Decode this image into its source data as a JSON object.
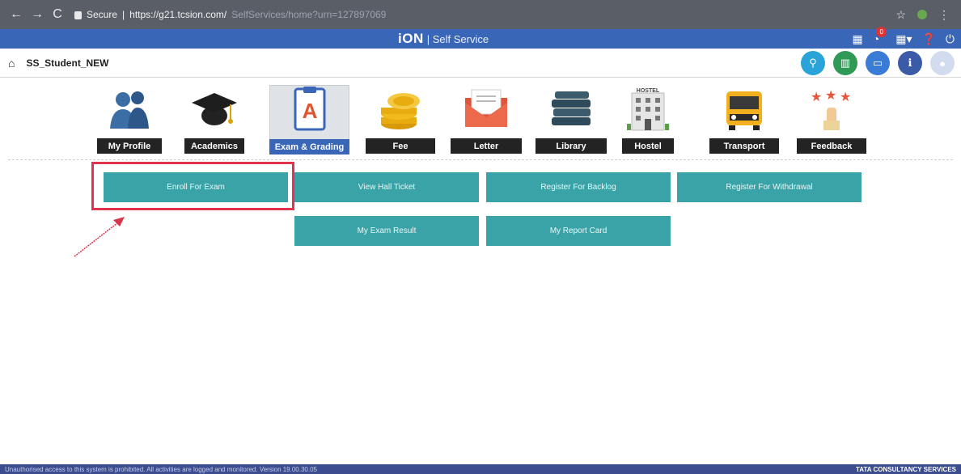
{
  "browser": {
    "secure_label": "Secure",
    "url_main": "https://g21.tcsion.com/",
    "url_rest": "SelfServices/home?urn=127897069"
  },
  "header": {
    "brand": "iON",
    "product": "| Self Service",
    "notification_count": "0"
  },
  "subheader": {
    "username": "SS_Student_NEW"
  },
  "modules": [
    {
      "label": "My Profile"
    },
    {
      "label": "Academics"
    },
    {
      "label": "Exam & Grading"
    },
    {
      "label": "Fee"
    },
    {
      "label": "Letter"
    },
    {
      "label": "Library"
    },
    {
      "label": "Hostel"
    },
    {
      "label": "Transport"
    },
    {
      "label": "Feedback"
    }
  ],
  "hostel_sign": "HOSTEL",
  "actions": {
    "enroll": "Enroll For Exam",
    "hall_ticket": "View Hall Ticket",
    "backlog": "Register For Backlog",
    "withdrawal": "Register For Withdrawal",
    "exam_result": "My Exam Result",
    "report_card": "My Report Card"
  },
  "footer": {
    "left": "Unauthorised access to this system is prohibited. All activities are logged and monitored. Version 19.00.30.05",
    "right": "TATA CONSULTANCY SERVICES"
  },
  "colors": {
    "header_blue": "#3a66b8",
    "teal_button": "#3aa3a7",
    "highlight_red": "#e0334c"
  }
}
